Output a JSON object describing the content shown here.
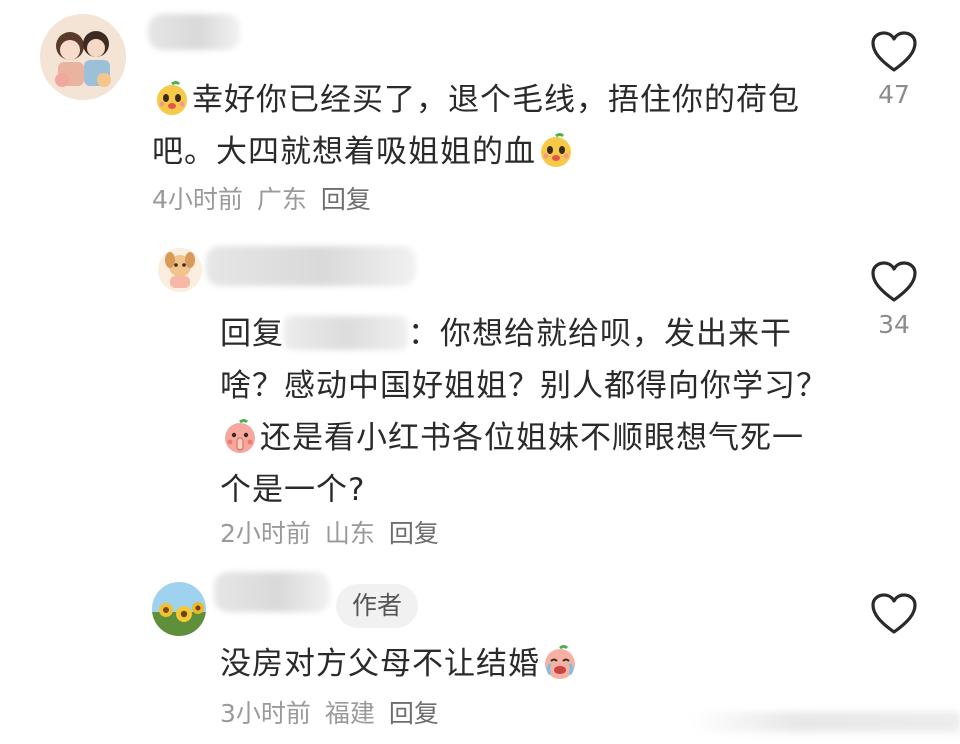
{
  "comments": [
    {
      "text_before": "幸好你已经买了，退个毛线，捂住你的荷包吧。大四就想着吸姐姐的血",
      "time": "4小时前",
      "location": "广东",
      "reply_label": "回复",
      "likes": "47",
      "emojis": [
        "cute-face-emoji",
        "cute-face-emoji"
      ]
    },
    {
      "reply_prefix": "回复",
      "reply_suffix": "：你想给就给呗，发出来干啥？感动中国好姐姐？别人都得向你学习？",
      "text_after": "还是看小红书各位姐妹不顺眼想气死一个是一个?",
      "time": "2小时前",
      "location": "山东",
      "reply_label": "回复",
      "likes": "34",
      "emojis": [
        "shush-face-emoji"
      ]
    },
    {
      "author_badge": "作者",
      "text": "没房对方父母不让结婚",
      "time": "3小时前",
      "location": "福建",
      "reply_label": "回复",
      "emojis": [
        "crying-face-emoji"
      ]
    }
  ],
  "icons": {
    "like": "heart-outline-icon"
  }
}
